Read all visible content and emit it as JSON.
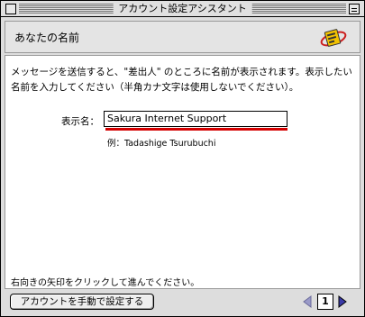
{
  "window": {
    "title": "アカウント設定アシスタント"
  },
  "header": {
    "heading": "あなたの名前",
    "logo_icon": "mail-envelope-logo-icon"
  },
  "main": {
    "instructions": "メッセージを送信すると、\"差出人\" のところに名前が表示されます。表示したい名前を入力してください（半角カナ文字は使用しないでください）。",
    "name_field": {
      "label": "表示名：",
      "value": "Sakura Internet Support"
    },
    "example": "例：Tadashige Tsurubuchi",
    "hint": "右向きの矢印をクリックして進んでください。"
  },
  "footer": {
    "manual_setup_label": "アカウントを手動で設定する",
    "page_number": "1",
    "prev_icon": "left-arrow-icon",
    "next_icon": "right-arrow-icon"
  },
  "colors": {
    "accent_red": "#d40000",
    "arrow_blue": "#3a3aa8",
    "prev_disabled": "#9a9ac8"
  }
}
